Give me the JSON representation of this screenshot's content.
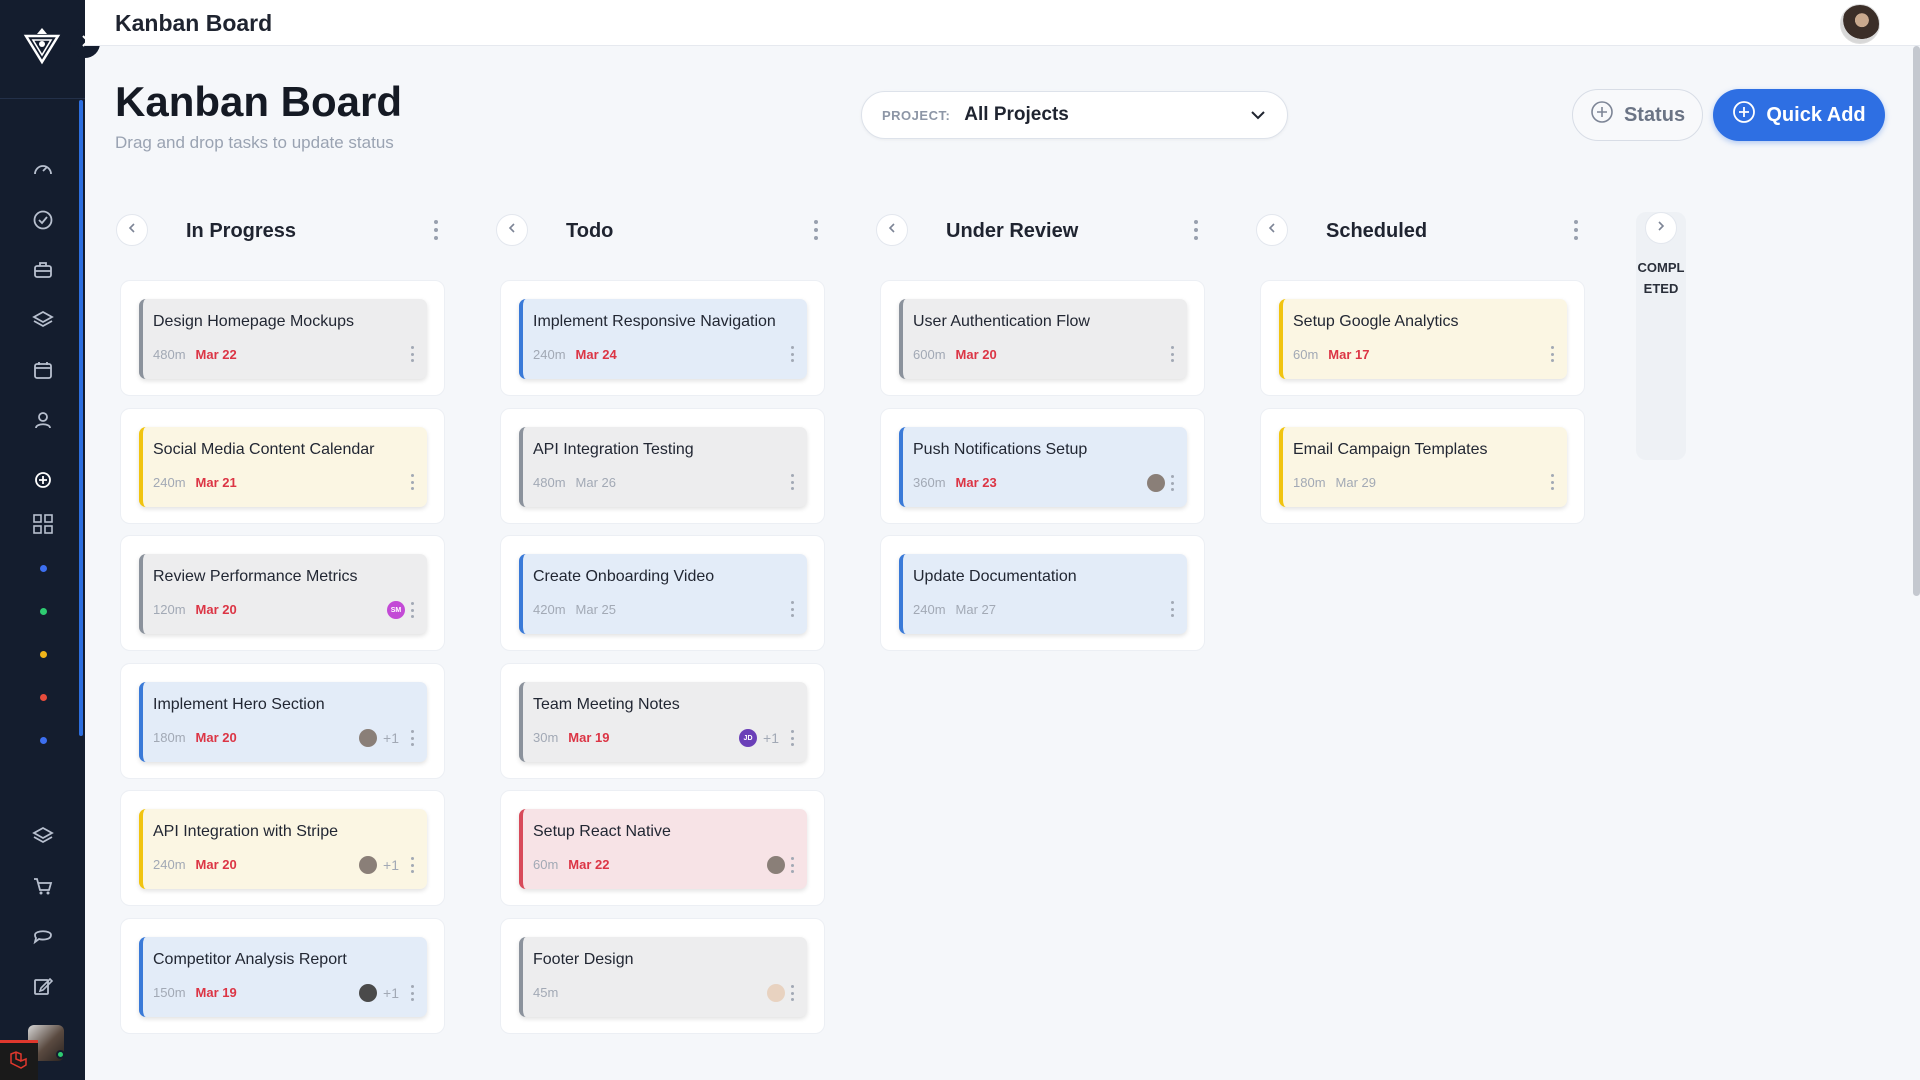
{
  "topbar": {
    "title": "Kanban Board"
  },
  "header": {
    "title": "Kanban Board",
    "subtitle": "Drag and drop tasks to update status",
    "project_label": "PROJECT:",
    "project_value": "All Projects",
    "status_button": "Status",
    "quick_add_button": "Quick Add"
  },
  "colors": {
    "accent": "#2e6fe3",
    "sidebar": "#141d2e",
    "overdue": "#dc3545"
  },
  "sidebar": {
    "icons": [
      "dashboard-icon",
      "check-circle-icon",
      "briefcase-icon",
      "layers-icon",
      "calendar-icon",
      "user-icon",
      "add-circle-icon",
      "grid-icon",
      "layers-icon",
      "cart-icon",
      "chat-icon",
      "edit-icon"
    ],
    "dots": [
      "#3d6ff0",
      "#2ecc71",
      "#f1b51a",
      "#e74c3c",
      "#3d6ff0"
    ]
  },
  "columns": [
    {
      "title": "In Progress",
      "cards": [
        {
          "title": "Design Homepage Mockups",
          "duration": "480m",
          "date": "Mar 22",
          "overdue": true,
          "color": "gray",
          "assignees": [],
          "extra": ""
        },
        {
          "title": "Social Media Content Calendar",
          "duration": "240m",
          "date": "Mar 21",
          "overdue": true,
          "color": "yellow",
          "assignees": [],
          "extra": ""
        },
        {
          "title": "Review Performance Metrics",
          "duration": "120m",
          "date": "Mar 20",
          "overdue": true,
          "color": "gray",
          "assignees": [
            {
              "initials": "SM",
              "bg": "#c34ad6"
            }
          ],
          "extra": ""
        },
        {
          "title": "Implement Hero Section",
          "duration": "180m",
          "date": "Mar 20",
          "overdue": true,
          "color": "blue",
          "assignees": [
            {
              "initials": "",
              "bg": "#8a7f78"
            }
          ],
          "extra": "+1"
        },
        {
          "title": "API Integration with Stripe",
          "duration": "240m",
          "date": "Mar 20",
          "overdue": true,
          "color": "yellow",
          "assignees": [
            {
              "initials": "",
              "bg": "#8a7f78"
            }
          ],
          "extra": "+1"
        },
        {
          "title": "Competitor Analysis Report",
          "duration": "150m",
          "date": "Mar 19",
          "overdue": true,
          "color": "blue",
          "assignees": [
            {
              "initials": "",
              "bg": "#4a4a4a"
            }
          ],
          "extra": "+1"
        }
      ]
    },
    {
      "title": "Todo",
      "cards": [
        {
          "title": "Implement Responsive Navigation",
          "duration": "240m",
          "date": "Mar 24",
          "overdue": true,
          "color": "blue",
          "assignees": [],
          "extra": ""
        },
        {
          "title": "API Integration Testing",
          "duration": "480m",
          "date": "Mar 26",
          "overdue": false,
          "color": "gray",
          "assignees": [],
          "extra": ""
        },
        {
          "title": "Create Onboarding Video",
          "duration": "420m",
          "date": "Mar 25",
          "overdue": false,
          "color": "blue",
          "assignees": [],
          "extra": ""
        },
        {
          "title": "Team Meeting Notes",
          "duration": "30m",
          "date": "Mar 19",
          "overdue": true,
          "color": "gray",
          "assignees": [
            {
              "initials": "JD",
              "bg": "#6a3fb8"
            }
          ],
          "extra": "+1"
        },
        {
          "title": "Setup React Native",
          "duration": "60m",
          "date": "Mar 22",
          "overdue": true,
          "color": "red",
          "assignees": [
            {
              "initials": "",
              "bg": "#8a7f78"
            }
          ],
          "extra": ""
        },
        {
          "title": "Footer Design",
          "duration": "45m",
          "date": "",
          "overdue": false,
          "color": "gray",
          "assignees": [
            {
              "initials": "",
              "bg": "#e8d2c0"
            }
          ],
          "extra": ""
        }
      ]
    },
    {
      "title": "Under Review",
      "cards": [
        {
          "title": "User Authentication Flow",
          "duration": "600m",
          "date": "Mar 20",
          "overdue": true,
          "color": "gray",
          "assignees": [],
          "extra": ""
        },
        {
          "title": "Push Notifications Setup",
          "duration": "360m",
          "date": "Mar 23",
          "overdue": true,
          "color": "blue",
          "assignees": [
            {
              "initials": "",
              "bg": "#8a7f78"
            }
          ],
          "extra": ""
        },
        {
          "title": "Update Documentation",
          "duration": "240m",
          "date": "Mar 27",
          "overdue": false,
          "color": "blue",
          "assignees": [],
          "extra": ""
        }
      ]
    },
    {
      "title": "Scheduled",
      "cards": [
        {
          "title": "Setup Google Analytics",
          "duration": "60m",
          "date": "Mar 17",
          "overdue": true,
          "color": "yellow",
          "assignees": [],
          "extra": ""
        },
        {
          "title": "Email Campaign Templates",
          "duration": "180m",
          "date": "Mar 29",
          "overdue": false,
          "color": "yellow",
          "assignees": [],
          "extra": ""
        }
      ]
    }
  ],
  "completed": {
    "label": "COMPLETED"
  }
}
